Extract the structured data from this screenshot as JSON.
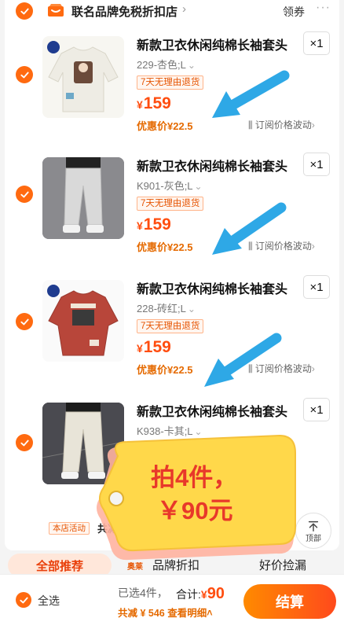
{
  "store": {
    "name": "联名品牌免税折扣店",
    "chevron": "›",
    "coupon_label": "领券",
    "more_label": "···",
    "icon": "store-icon"
  },
  "items": [
    {
      "title": "新款卫衣休闲纯棉长袖套头",
      "sku": "229-杏色;L",
      "quantity": "×1",
      "return_tag": "7天无理由退货",
      "currency": "¥",
      "price": "159",
      "promo_price": "优惠价¥22.5",
      "subscribe": "订阅价格波动",
      "thumb_color": "#eeece4"
    },
    {
      "title": "新款卫衣休闲纯棉长袖套头",
      "sku": "K901-灰色;L",
      "quantity": "×1",
      "return_tag": "7天无理由退货",
      "currency": "¥",
      "price": "159",
      "promo_price": "优惠价¥22.5",
      "subscribe": "订阅价格波动",
      "thumb_color": "#cfcfcf"
    },
    {
      "title": "新款卫衣休闲纯棉长袖套头",
      "sku": "228-砖红;L",
      "quantity": "×1",
      "return_tag": "7天无理由退货",
      "currency": "¥",
      "price": "159",
      "promo_price": "优惠价¥22.5",
      "subscribe": "订阅价格波动",
      "thumb_color": "#b8463a"
    },
    {
      "title": "新款卫衣休闲纯棉长袖套头",
      "sku": "K938-卡其;L",
      "quantity": "×1",
      "thumb_color": "#e8e4d8"
    }
  ],
  "shop_activity": {
    "tag": "本店活动",
    "text": "共减"
  },
  "promo_overlay": {
    "line1": "拍4件，",
    "line2": "￥90元"
  },
  "back_to_top": {
    "label": "顶部",
    "icon": "arrow-up-icon"
  },
  "recommend": {
    "all_label": "全部推荐",
    "badge": "奥莱",
    "brand_label": "品牌折扣",
    "deal_label": "好价捡漏"
  },
  "bottom_bar": {
    "select_all": "全选",
    "selected_count": "已选4件，",
    "total_label": "合计:",
    "total_currency": "¥",
    "total_amount": "90",
    "saved_text": "共减 ¥ 546",
    "detail_link": "查看明细",
    "checkout_label": "结算"
  },
  "colors": {
    "accent": "#ff6a10",
    "price": "#ff4d0f",
    "promo": "#e56a00",
    "annotation_arrow": "#2ea8e6",
    "tag_yellow": "#ffd84a"
  }
}
